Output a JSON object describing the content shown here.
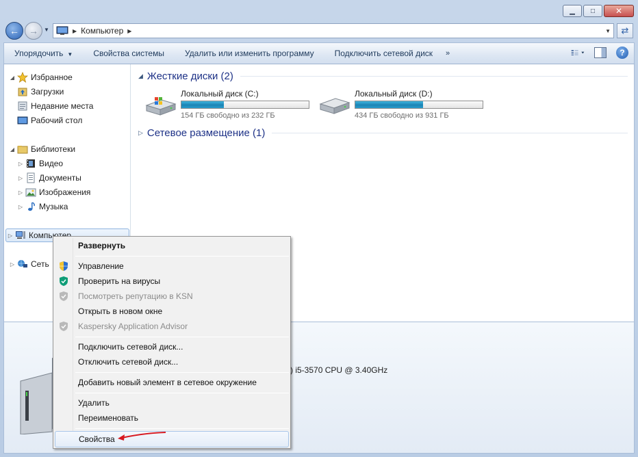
{
  "window": {
    "caption_buttons": {
      "minimize": "▁",
      "maximize": "□",
      "close": "✕"
    }
  },
  "address": {
    "breadcrumb": "Компьютер"
  },
  "colors": {
    "accent": "#1e3287",
    "drive_bar": "#1b84b5",
    "red_arrow": "#d71920"
  },
  "toolbar": {
    "organize": "Упорядочить",
    "system_properties": "Свойства системы",
    "uninstall": "Удалить или изменить программу",
    "map_drive": "Подключить сетевой диск",
    "more": "»"
  },
  "sidebar": {
    "favorites": "Избранное",
    "downloads": "Загрузки",
    "recent": "Недавние места",
    "desktop": "Рабочий стол",
    "libraries": "Библиотеки",
    "video": "Видео",
    "documents": "Документы",
    "images": "Изображения",
    "music": "Музыка",
    "computer": "Компьютер",
    "network": "Сеть"
  },
  "main": {
    "hard_drives_header": "Жесткие диски (2)",
    "network_header": "Сетевое размещение (1)",
    "drives": [
      {
        "name": "Локальный диск (C:)",
        "free": "154 ГБ свободно из 232 ГБ",
        "used_fraction": 0.336
      },
      {
        "name": "Локальный диск (D:)",
        "free": "434 ГБ свободно из 931 ГБ",
        "used_fraction": 0.534
      }
    ]
  },
  "details": {
    "cpu": ") i5-3570 CPU @ 3.40GHz"
  },
  "context_menu": {
    "expand": "Развернуть",
    "manage": "Управление",
    "scan": "Проверить на вирусы",
    "ksn": "Посмотреть репутацию в KSN",
    "new_window": "Открыть в новом окне",
    "kaspersky": "Kaspersky Application Advisor",
    "map_drive": "Подключить сетевой диск...",
    "disconnect_drive": "Отключить сетевой диск...",
    "add_network": "Добавить новый элемент в сетевое окружение",
    "delete": "Удалить",
    "rename": "Переименовать",
    "properties": "Свойства"
  }
}
